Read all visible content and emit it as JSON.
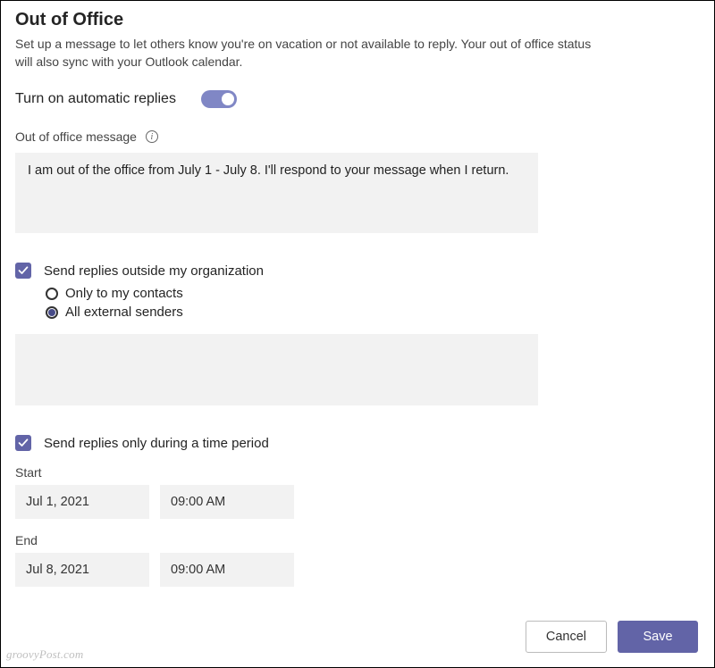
{
  "header": {
    "title": "Out of Office",
    "description": "Set up a message to let others know you're on vacation or not available to reply. Your out of office status will also sync with your Outlook calendar."
  },
  "autoReplies": {
    "label": "Turn on automatic replies",
    "on": true
  },
  "message": {
    "label": "Out of office message",
    "text": "I am out of the office from July 1 - July 8. I'll respond to your message when I return."
  },
  "external": {
    "label": "Send replies outside my organization",
    "checked": true,
    "options": {
      "contacts": "Only to my contacts",
      "all": "All external senders"
    },
    "selected": "all",
    "message": ""
  },
  "schedule": {
    "label": "Send replies only during a time period",
    "checked": true,
    "startLabel": "Start",
    "endLabel": "End",
    "startDate": "Jul 1, 2021",
    "startTime": "09:00 AM",
    "endDate": "Jul 8, 2021",
    "endTime": "09:00 AM"
  },
  "buttons": {
    "cancel": "Cancel",
    "save": "Save"
  },
  "watermark": "groovyPost.com"
}
